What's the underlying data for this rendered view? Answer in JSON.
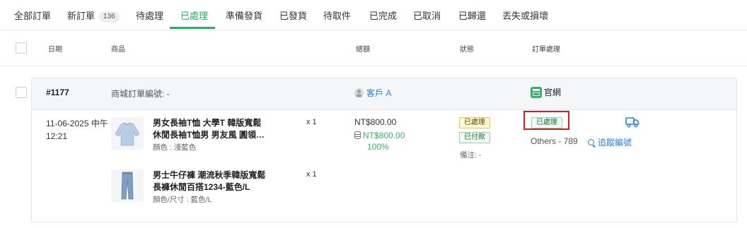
{
  "tabs": [
    {
      "label": "全部訂單"
    },
    {
      "label": "新訂單",
      "count": "136"
    },
    {
      "label": "待處理"
    },
    {
      "label": "已處理",
      "active": true
    },
    {
      "label": "準備發貨"
    },
    {
      "label": "已發貨"
    },
    {
      "label": "待取件"
    },
    {
      "label": "已完成"
    },
    {
      "label": "已取消"
    },
    {
      "label": "已歸還"
    },
    {
      "label": "丟失或損壞"
    }
  ],
  "table_headers": {
    "date": "日期",
    "product": "商品",
    "total": "總額",
    "status": "狀態",
    "processing": "訂單處理"
  },
  "order": {
    "number": "#1177",
    "mall_order_label": "商城訂單編號: -",
    "customer": "客戶 A",
    "channel": "官網",
    "date_line1": "11-06-2025 中午",
    "date_line2": "12:21",
    "items": [
      {
        "name_line1": "男女長袖T恤 大學T 韓版寬鬆",
        "name_line2": "休閒長袖T恤男 男友風 圓領…",
        "variant": "顏色 : 淺藍色",
        "qty": "x 1",
        "thumb_icon": "sweatshirt-image"
      },
      {
        "name_line1": "男士牛仔褲 潮流秋季韓版寬鬆",
        "name_line2": "長褲休閒百搭1234-藍色/L",
        "variant": "顏色/尺寸 : 藍色/L",
        "qty": "x 1",
        "thumb_icon": "jeans-image"
      }
    ],
    "total": "NT$800.00",
    "paid_amount": "NT$800.00",
    "paid_percent": "100%",
    "status_tags": [
      "已處理",
      "已付款"
    ],
    "remark": "備注: -",
    "processing_status": "已處理",
    "shipping": "Others - 789",
    "tracking_link": "追蹤編號"
  },
  "colors": {
    "accent_green": "#2bae66",
    "link_blue": "#2a7de1",
    "highlight_red": "#e01a1a",
    "tag_yellow_border": "#f0c24a",
    "tag_green_border": "#8fd4a8"
  },
  "icons": [
    "user-icon",
    "shop-icon",
    "database-icon",
    "truck-icon",
    "search-icon"
  ]
}
